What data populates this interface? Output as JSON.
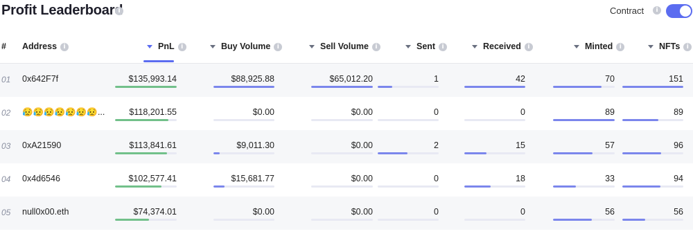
{
  "header": {
    "title": "Profit Leaderboard",
    "contract_label": "Contract",
    "contract_toggle_on": true,
    "accent_color": "#5b6cf0"
  },
  "columns": {
    "rank": "#",
    "address": "Address",
    "pnl": "PnL",
    "buy_volume": "Buy Volume",
    "sell_volume": "Sell Volume",
    "sent": "Sent",
    "received": "Received",
    "minted": "Minted",
    "nfts": "NFTs",
    "sorted_by": "PnL"
  },
  "rows": [
    {
      "rank": "01",
      "address": "0x642F7f",
      "address_emoji": false,
      "pnl": "$135,993.14",
      "pnl_frac": 1.0,
      "buy_volume": "$88,925.88",
      "buy_frac": 1.0,
      "sell_volume": "$65,012.20",
      "sell_frac": 1.0,
      "sent": "1",
      "sent_frac": 0.24,
      "received": "42",
      "received_frac": 1.0,
      "minted": "70",
      "minted_frac": 0.79,
      "nfts": "151",
      "nfts_frac": 1.0
    },
    {
      "rank": "02",
      "address": "😥😥😥😥😥😥😥...",
      "address_emoji": true,
      "pnl": "$118,201.55",
      "pnl_frac": 0.87,
      "buy_volume": "$0.00",
      "buy_frac": 0.0,
      "sell_volume": "$0.00",
      "sell_frac": 0.0,
      "sent": "0",
      "sent_frac": 0.0,
      "received": "0",
      "received_frac": 0.0,
      "minted": "89",
      "minted_frac": 1.0,
      "nfts": "89",
      "nfts_frac": 0.59
    },
    {
      "rank": "03",
      "address": "0xA21590",
      "address_emoji": false,
      "pnl": "$113,841.61",
      "pnl_frac": 0.84,
      "buy_volume": "$9,011.30",
      "buy_frac": 0.1,
      "sell_volume": "$0.00",
      "sell_frac": 0.0,
      "sent": "2",
      "sent_frac": 0.49,
      "received": "15",
      "received_frac": 0.36,
      "minted": "57",
      "minted_frac": 0.64,
      "nfts": "96",
      "nfts_frac": 0.64
    },
    {
      "rank": "04",
      "address": "0x4d6546",
      "address_emoji": false,
      "pnl": "$102,577.41",
      "pnl_frac": 0.75,
      "buy_volume": "$15,681.77",
      "buy_frac": 0.18,
      "sell_volume": "$0.00",
      "sell_frac": 0.0,
      "sent": "0",
      "sent_frac": 0.0,
      "received": "18",
      "received_frac": 0.43,
      "minted": "33",
      "minted_frac": 0.37,
      "nfts": "94",
      "nfts_frac": 0.62
    },
    {
      "rank": "05",
      "address": "null0x00.eth",
      "address_emoji": false,
      "pnl": "$74,374.01",
      "pnl_frac": 0.55,
      "buy_volume": "$0.00",
      "buy_frac": 0.0,
      "sell_volume": "$0.00",
      "sell_frac": 0.0,
      "sent": "0",
      "sent_frac": 0.0,
      "received": "0",
      "received_frac": 0.0,
      "minted": "56",
      "minted_frac": 0.63,
      "nfts": "56",
      "nfts_frac": 0.37
    }
  ]
}
